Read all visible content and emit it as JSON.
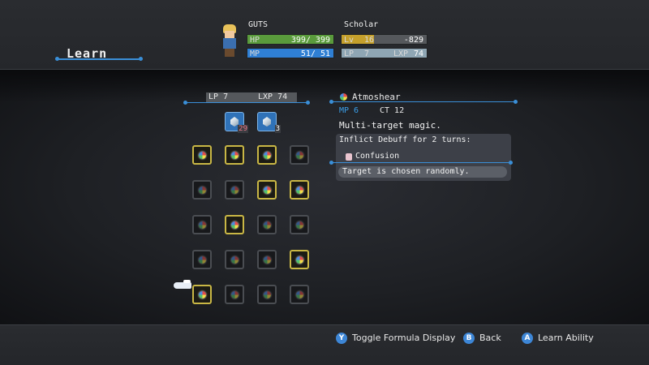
{
  "screen_title": "Learn",
  "character": {
    "name": "GUTS",
    "job": "Scholar",
    "hp_label": "HP",
    "hp_value": "399/ 399",
    "hp_fraction": 1.0,
    "mp_label": "MP",
    "mp_value": "51/ 51",
    "mp_fraction": 1.0,
    "lv_label": "Lv",
    "lv_value": "16",
    "lv_next": "-829",
    "lv_fraction": 0.38,
    "lp_label": "LP",
    "lp_value": "7",
    "lxp_label": "LXP",
    "lxp_value": "74"
  },
  "grid_header": {
    "lp_label": "LP",
    "lp_value": "7",
    "lxp_label": "LXP",
    "lxp_value": "74"
  },
  "formulas": [
    {
      "count": "29",
      "count_color": "red"
    },
    {
      "count": "3",
      "count_color": "white"
    }
  ],
  "abilities_grid": [
    [
      "learned",
      "learned",
      "learned",
      "unlearned"
    ],
    [
      "unlearned",
      "unlearned",
      "learned",
      "learned"
    ],
    [
      "unlearned",
      "learned",
      "unlearned",
      "unlearned"
    ],
    [
      "unlearned",
      "unlearned",
      "unlearned",
      "learned"
    ],
    [
      "learned",
      "unlearned",
      "unlearned",
      "unlearned"
    ]
  ],
  "selected_ability": {
    "name": "Atmoshear",
    "mp": "MP 6",
    "ct": "CT 12",
    "description": "Multi-target magic.",
    "effect_line": "Inflict Debuff for 2 turns:",
    "effect_name": "Confusion",
    "note": "Target is chosen randomly."
  },
  "colors": {
    "accent": "#3a8fd8",
    "hp_fill": "#5a9b3c",
    "mp_fill": "#2f7fd4",
    "lv_fill": "#c5a02c",
    "lp_fill": "#8fa6b4",
    "learned_border": "#c9b745"
  },
  "hints": [
    {
      "button": "Y",
      "label": "Toggle Formula Display"
    },
    {
      "button": "B",
      "label": "Back"
    },
    {
      "button": "A",
      "label": "Learn Ability"
    }
  ]
}
